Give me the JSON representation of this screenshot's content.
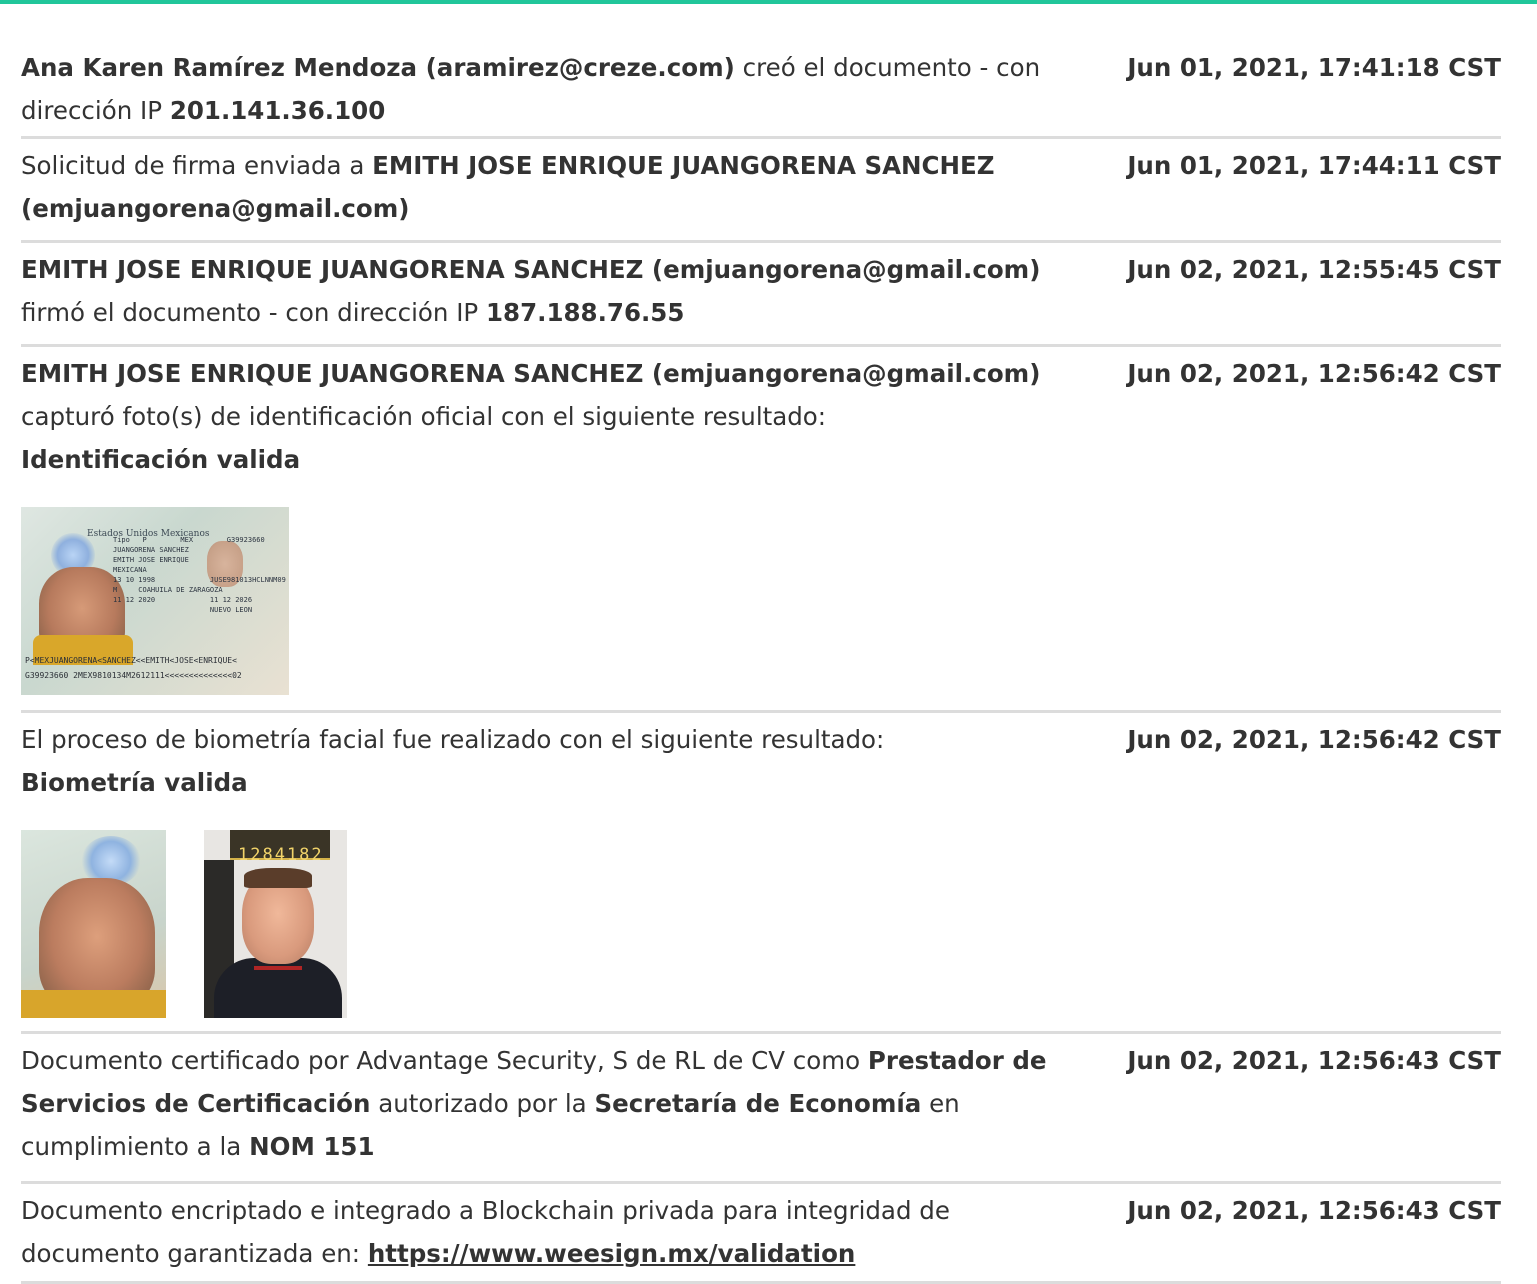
{
  "entries": [
    {
      "parts": [
        {
          "b": "Ana Karen Ramírez Mendoza (aramirez@creze.com)"
        },
        {
          "t": " creó el documento - con dirección IP "
        },
        {
          "b": "201.141.36.100"
        }
      ],
      "timestamp": "Jun 01, 2021, 17:41:18 CST"
    },
    {
      "parts": [
        {
          "t": "Solicitud de firma enviada a "
        },
        {
          "b": "EMITH JOSE ENRIQUE JUANGORENA SANCHEZ (emjuangorena@gmail.com)"
        }
      ],
      "timestamp": "Jun 01, 2021, 17:44:11 CST"
    },
    {
      "parts": [
        {
          "b": "EMITH JOSE ENRIQUE JUANGORENA SANCHEZ (emjuangorena@gmail.com)"
        },
        {
          "t": " firmó el documento - con dirección IP "
        },
        {
          "b": "187.188.76.55"
        }
      ],
      "timestamp": "Jun 02, 2021, 12:55:45 CST"
    },
    {
      "lead_bold": "EMITH JOSE ENRIQUE JUANGORENA SANCHEZ (emjuangorena@gmail.com)",
      "line2": "capturó foto(s) de identificación oficial con el siguiente resultado:",
      "result": "Identificación valida",
      "timestamp": "Jun 02, 2021, 12:56:42 CST",
      "id_card": {
        "header": "Estados Unidos Mexicanos",
        "text_block": "Tipo   P        MEX        G39923660\nJUANGORENA SANCHEZ\nEMITH JOSE ENRIQUE\nMEXICANA\n13 10 1998             JUSE981013HCLNNM09\nM     COAHUILA DE ZARAGOZA\n11 12 2020             11 12 2026\n                       NUEVO LEON",
        "mrz_1": "P<MEXJUANGORENA<SANCHEZ<<EMITH<JOSE<ENRIQUE<",
        "mrz_2": "G39923660 2MEX9810134M2612111<<<<<<<<<<<<<<02"
      }
    },
    {
      "line1": "El proceso de biometría facial fue realizado con el siguiente resultado:",
      "result": "Biometría valida",
      "timestamp": "Jun 02, 2021, 12:56:42 CST",
      "selfie_sign_text": "1284182"
    },
    {
      "parts": [
        {
          "t": "Documento certificado por Advantage Security, S de RL de CV como "
        },
        {
          "b": "Prestador de Servicios de Certificación"
        },
        {
          "t": " autorizado por la "
        },
        {
          "b": "Secretaría de Economía"
        },
        {
          "t": " en cumplimiento a la "
        },
        {
          "b": "NOM 151"
        }
      ],
      "timestamp": "Jun 02, 2021, 12:56:43 CST"
    },
    {
      "text": "Documento encriptado e integrado a Blockchain privada para integridad de documento garantizada en: ",
      "link": "https://www.weesign.mx/validation",
      "timestamp": "Jun 02, 2021, 12:56:43 CST"
    }
  ]
}
